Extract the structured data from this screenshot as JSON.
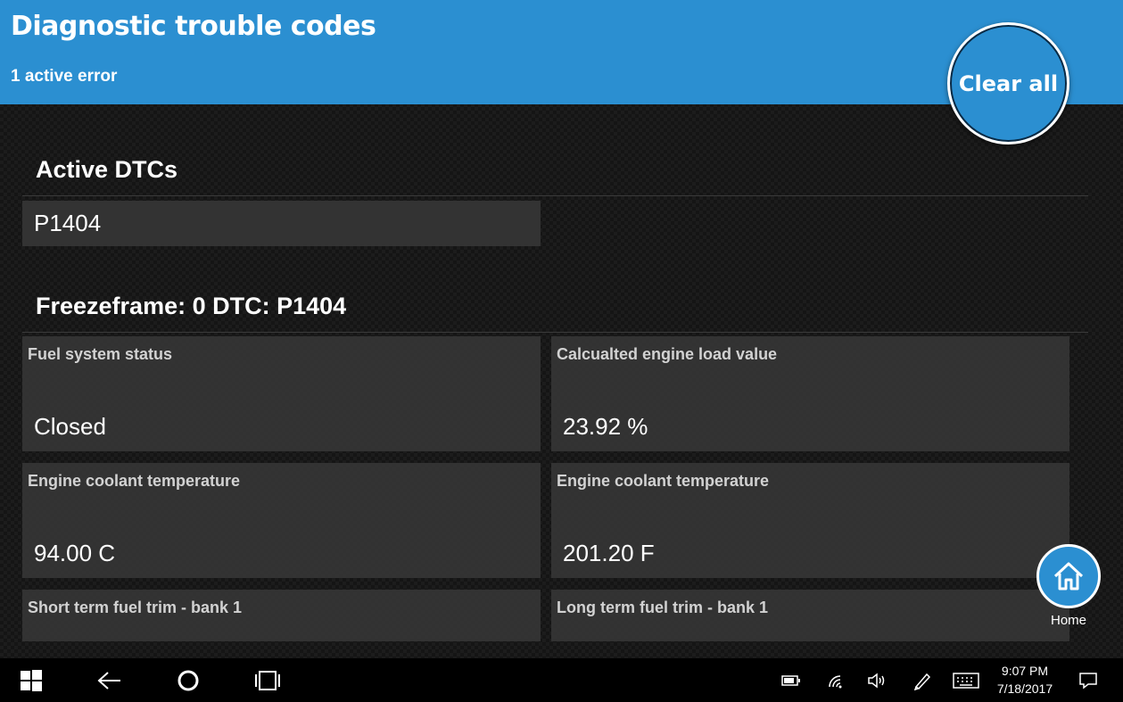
{
  "header": {
    "title": "Diagnostic trouble codes",
    "subtitle": "1 active error",
    "clear_label": "Clear all"
  },
  "active": {
    "title": "Active DTCs",
    "codes": [
      "P1404"
    ]
  },
  "freeze": {
    "title": "Freezeframe: 0 DTC: P1404",
    "tiles": [
      {
        "label": "Fuel system status",
        "value": "Closed"
      },
      {
        "label": "Calcualted engine load value",
        "value": "23.92 %"
      },
      {
        "label": "Engine coolant temperature",
        "value": "94.00 C"
      },
      {
        "label": "Engine coolant temperature",
        "value": "201.20 F"
      },
      {
        "label": "Short term fuel trim - bank 1",
        "value": ""
      },
      {
        "label": "Long term fuel trim - bank 1",
        "value": ""
      }
    ]
  },
  "nav": {
    "home_label": "Home"
  },
  "taskbar": {
    "time": "9:07 PM",
    "date": "7/18/2017",
    "icons": [
      "windows-start-icon",
      "back-arrow-icon",
      "cortana-circle-icon",
      "task-view-icon",
      "battery-icon",
      "wifi-icon",
      "volume-icon",
      "pen-icon",
      "keyboard-icon",
      "notification-icon"
    ]
  },
  "colors": {
    "accent": "#2b8fd1",
    "tile": "#373737",
    "taskbar": "#000000"
  }
}
